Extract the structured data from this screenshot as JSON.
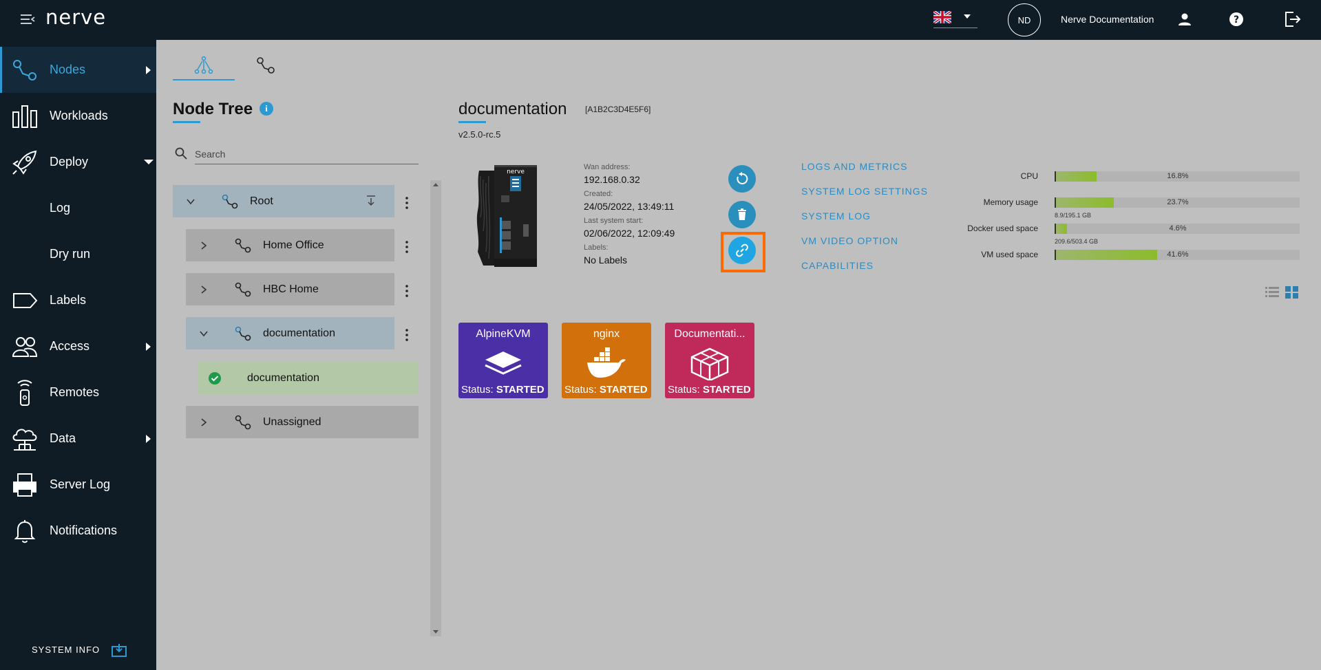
{
  "app": {
    "logo": "nerve",
    "user_initials": "ND",
    "user_name": "Nerve Documentation"
  },
  "sidebar": {
    "items": [
      {
        "label": "Nodes"
      },
      {
        "label": "Workloads"
      },
      {
        "label": "Deploy"
      },
      {
        "label": "Log"
      },
      {
        "label": "Dry run"
      },
      {
        "label": "Labels"
      },
      {
        "label": "Access"
      },
      {
        "label": "Remotes"
      },
      {
        "label": "Data"
      },
      {
        "label": "Server Log"
      },
      {
        "label": "Notifications"
      }
    ],
    "system_info": "SYSTEM INFO"
  },
  "tree": {
    "title": "Node Tree",
    "search_placeholder": "Search",
    "nodes": [
      {
        "label": "Root"
      },
      {
        "label": "Home Office"
      },
      {
        "label": "HBC Home"
      },
      {
        "label": "documentation"
      },
      {
        "label": "documentation"
      },
      {
        "label": "Unassigned"
      }
    ]
  },
  "node": {
    "name": "documentation",
    "serial": "[A1B2C3D4E5F6]",
    "version": "v2.5.0-rc.5",
    "wan_label": "Wan address:",
    "wan_value": "192.168.0.32",
    "created_label": "Created:",
    "created_value": "24/05/2022, 13:49:11",
    "last_start_label": "Last system start:",
    "last_start_value": "02/06/2022, 12:09:49",
    "labels_label": "Labels:",
    "labels_value": "No Labels",
    "links": [
      "LOGS AND METRICS",
      "SYSTEM LOG SETTINGS",
      "SYSTEM LOG",
      "VM VIDEO OPTION",
      "CAPABILITIES"
    ]
  },
  "metrics": [
    {
      "label": "CPU",
      "value": "16.8%",
      "fraction": 0.168,
      "sub": ""
    },
    {
      "label": "Memory usage",
      "value": "23.7%",
      "fraction": 0.237,
      "sub": "8.9/195.1 GB"
    },
    {
      "label": "Docker used space",
      "value": "4.6%",
      "fraction": 0.046,
      "sub": "209.6/503.4 GB"
    },
    {
      "label": "VM used space",
      "value": "41.6%",
      "fraction": 0.416,
      "sub": ""
    }
  ],
  "workloads": [
    {
      "name": "AlpineKVM",
      "status_label": "Status:",
      "status": "STARTED",
      "color": "#4a2fa6",
      "icon": "vm-layers-icon"
    },
    {
      "name": "nginx",
      "status_label": "Status:",
      "status": "STARTED",
      "color": "#d2700c",
      "icon": "docker-whale-icon"
    },
    {
      "name": "Documentati...",
      "status_label": "Status:",
      "status": "STARTED",
      "color": "#bf2a5a",
      "icon": "compose-cubes-icon"
    }
  ],
  "colors": {
    "accent": "#2c9ad1",
    "sidebar_bg": "#0f1b25",
    "highlight": "#ff6a00"
  }
}
